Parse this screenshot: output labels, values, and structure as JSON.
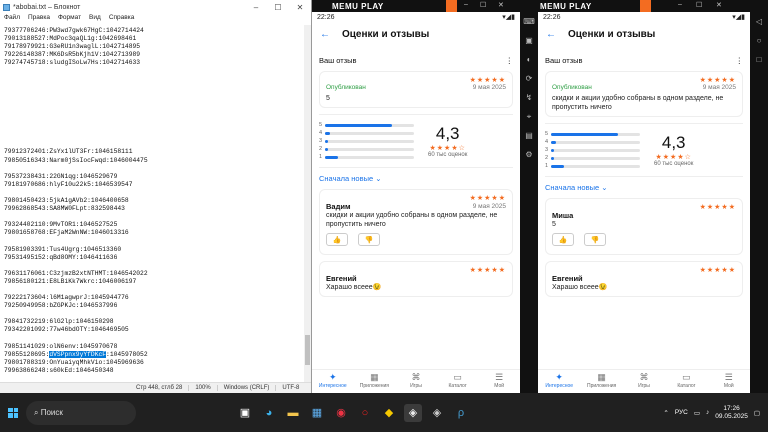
{
  "notepad": {
    "title": "*abobai.txt – Блокнот",
    "menu": [
      "Файл",
      "Правка",
      "Формат",
      "Вид",
      "Справка"
    ],
    "lines": [
      "79377706246:PW3wd7gwk67HgC:1042714424",
      "79013188527:MdPoc3qaQL1g:1042698461",
      "79178979921:G3eRU1n3waglL:1042714895",
      "79226148387:MK6DsR5bKjh1V:1042713989",
      "79274745718:sludgISoLw7Hs:1042714633",
      "",
      "",
      "",
      "",
      "",
      "",
      "",
      "",
      "",
      "",
      "79912372401:ZsYx1lUT3Fr:1046158111",
      "79850516343:Narm0jSsIocFwqd:1046004475",
      "",
      "79537238431:22GN1qg:1046529679",
      "79181970686:hlyF10u22k5:1046539547",
      "",
      "79801450423:5jkA1gAVb2:1046400658",
      "79962868543:SA8MW0FLpt:832598443",
      "",
      "79324402110:9MvTOR1:1046527525",
      "79801658768:EFjaM2WnNW:1046013316",
      "",
      "79581903391:Tus4Ugrg:1046513360",
      "79531495152:qBd8OMY:1046411636",
      "",
      "79631176061:C3zjmzB2xtNTHMT:1046542022",
      "79856180121:E8LBiKk7Wkrc:1046006197",
      "",
      "79222173604:l6M1agwprJ:1045944776",
      "79250949958:bZGPKJc:1046537996",
      "",
      "79841732219:6lG2lp:1046150298",
      "79342201092:77w46bdOTY:1046469505",
      "",
      "79851141029:olN6env:1045970678",
      "79855128695:",
      "79801788319:OnYuaiyqMhkVio:1045969636",
      "79963866248:s60kEd:1046450348"
    ],
    "hl_text": "dVSPpnx9yYfDKcF",
    "hl_rest": ":1045978052",
    "status": [
      "Стр 448, стлб 28",
      "100%",
      "Windows (CRLF)",
      "UTF-8"
    ]
  },
  "emu1": {
    "logo": "MEMU PLAY",
    "time": "22:26"
  },
  "emu2": {
    "logo": "MEMU PLAY",
    "time": "22:26"
  },
  "app": {
    "title": "Оценки и отзывы",
    "your_review": "Ваш отзыв",
    "published": "Опубликован",
    "date": "9 мая 2025",
    "my_text_1": "5",
    "my_text_2": "скидки и акции удобно собраны в одном разделе, не пропустить ничего",
    "score": "4,3",
    "score_stars": "★★★★☆",
    "count": "60 тыс оценок",
    "sort": "Сначала новые ⌄",
    "bars": [
      {
        "n": "5",
        "v": 0.75
      },
      {
        "n": "4",
        "v": 0.05
      },
      {
        "n": "3",
        "v": 0.03
      },
      {
        "n": "2",
        "v": 0.03
      },
      {
        "n": "1",
        "v": 0.15
      }
    ],
    "stars": "★★★★★",
    "r1": {
      "name": "Вадим",
      "date": "9 мая 2025",
      "text": "скидки и акции удобно собраны в одном разделе, не пропустить ничего"
    },
    "r1b": {
      "name": "Миша",
      "date": "9 мая 2025",
      "text": "5"
    },
    "r2": {
      "name": "Евгений",
      "date": "9 мая 2025",
      "text": "Харашо всеее😉"
    },
    "nav": [
      "Интересное",
      "Приложения",
      "Игры",
      "Каталог",
      "Мой"
    ]
  },
  "taskbar": {
    "search": "Поиск",
    "lang": "РУС",
    "time": "17:26",
    "date": "09.05.2025"
  }
}
